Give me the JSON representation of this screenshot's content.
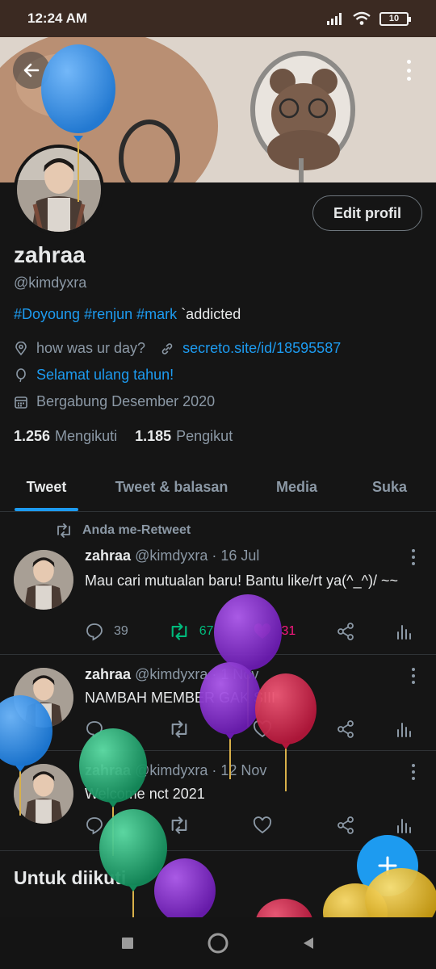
{
  "status_bar": {
    "time": "12:24 AM",
    "battery": "10"
  },
  "profile": {
    "name": "zahraa",
    "handle": "@kimdyxra",
    "edit_button": "Edit profil",
    "bio_tags": [
      "#Doyoung",
      "#renjun",
      "#mark"
    ],
    "bio_text": "`addicted",
    "location": "how was ur day?",
    "website": "secreto.site/id/18595587",
    "birthday": "Selamat ulang tahun!",
    "joined": "Bergabung Desember 2020",
    "following_count": "1.256",
    "following_label": "Mengikuti",
    "followers_count": "1.185",
    "followers_label": "Pengikut"
  },
  "tabs": [
    {
      "label": "Tweet"
    },
    {
      "label": "Tweet & balasan"
    },
    {
      "label": "Media"
    },
    {
      "label": "Suka"
    }
  ],
  "retweet_note": "Anda me-Retweet",
  "tweets": [
    {
      "name": "zahraa",
      "meta": "@kimdyxra · 16 Jul",
      "text": "Mau cari mutualan baru! Bantu like/rt ya(^_^)/ ~~",
      "replies": "39",
      "retweets": "67",
      "likes": "31"
    },
    {
      "name": "zahraa",
      "meta": "@kimdyxra · 1 Nov",
      "text": "NAMBAH MEMBER GAK SIII",
      "replies": "",
      "retweets": "",
      "likes": ""
    },
    {
      "name": "zahraa",
      "meta": "@kimdyxra · 12 Nov",
      "text": "Welcome nct 2021",
      "replies": "",
      "retweets": "",
      "likes": ""
    }
  ],
  "section_title": "Untuk diikuti",
  "colors": {
    "accent": "#1d9bf0",
    "retweet": "#00ba7c",
    "like": "#f91880",
    "background": "#151515"
  },
  "icons": [
    "back-arrow-icon",
    "more-vertical-icon",
    "location-icon",
    "link-icon",
    "balloon-icon",
    "calendar-icon",
    "retweet-icon",
    "reply-icon",
    "like-icon",
    "share-icon",
    "analytics-icon",
    "plus-icon"
  ]
}
